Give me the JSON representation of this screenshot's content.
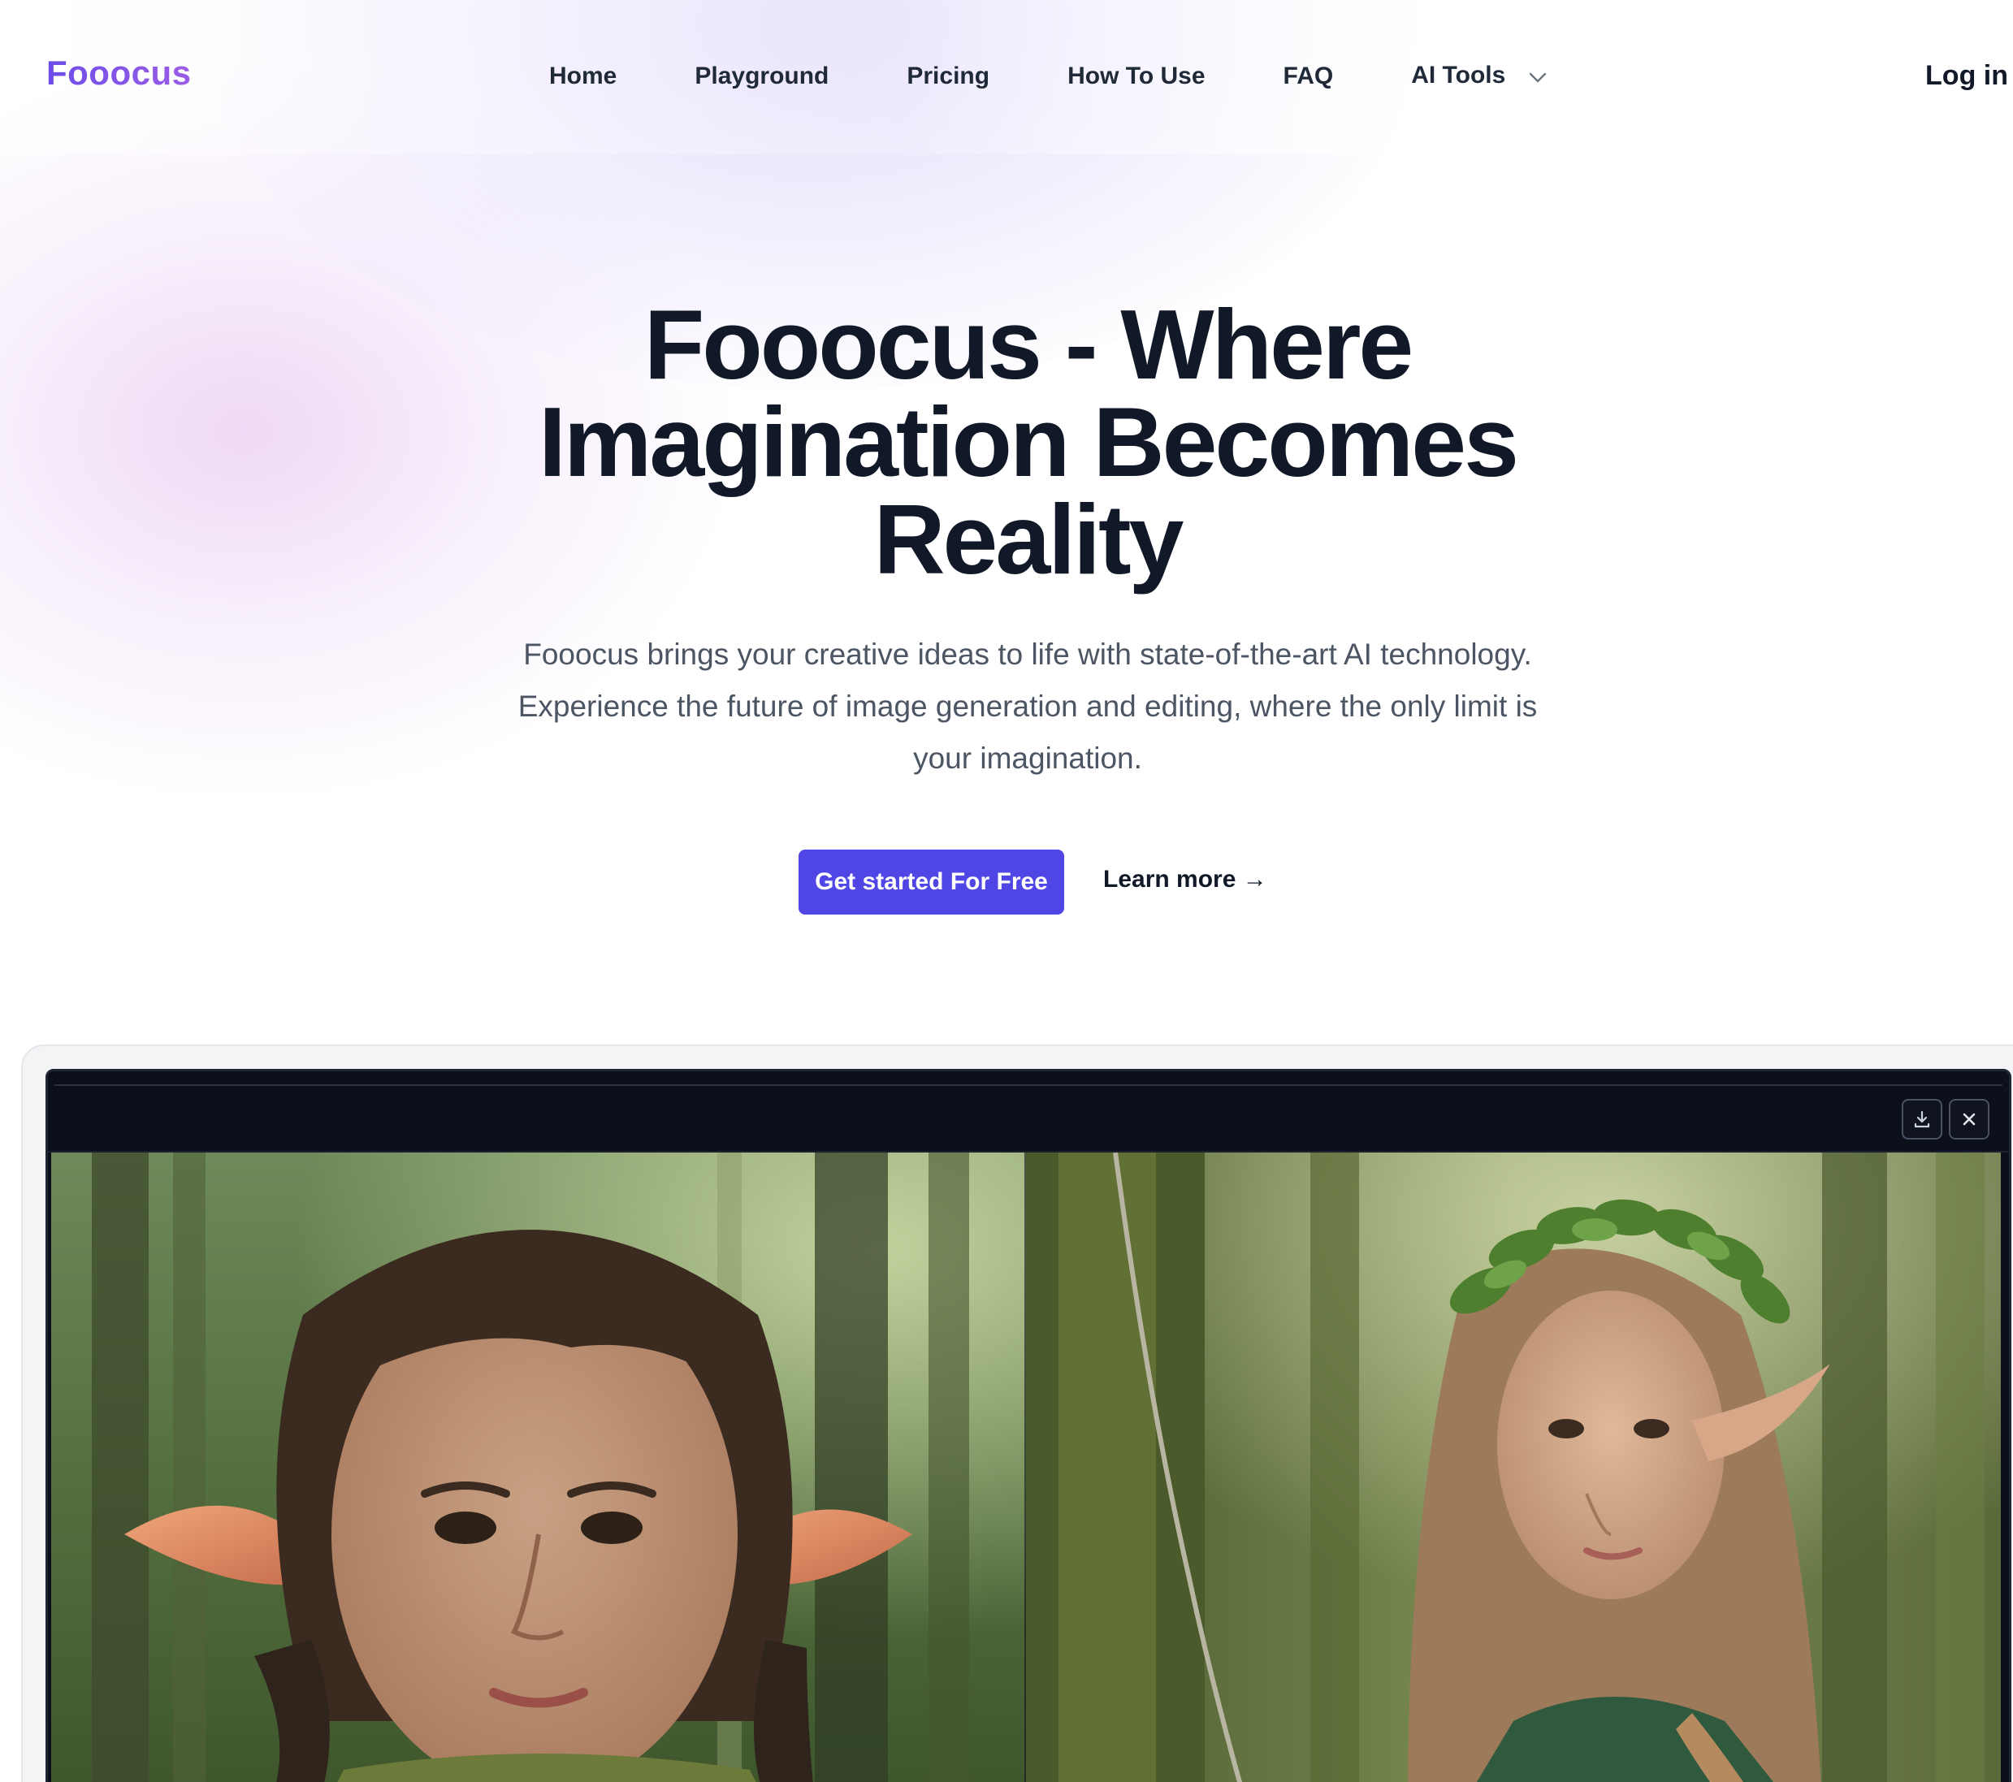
{
  "brand": {
    "logo": "Fooocus"
  },
  "nav": {
    "links": [
      "Home",
      "Playground",
      "Pricing",
      "How To Use",
      "FAQ"
    ],
    "ai_tools": "AI Tools",
    "login": "Log in"
  },
  "hero": {
    "title_lines": [
      "Fooocus - Where",
      "Imagination Becomes",
      "Reality"
    ],
    "subtitle_lines": [
      "Fooocus brings your creative ideas to life with state-of-the-art AI technology.",
      "Experience the future of image generation and editing, where the only limit is",
      "your imagination."
    ],
    "cta_primary": "Get started For Free",
    "cta_secondary": "Learn more →"
  },
  "preview": {
    "toolbar_icons": [
      "download-icon",
      "close-icon"
    ]
  },
  "colors": {
    "accent": "#4f46e5",
    "logo_gradient_start": "#6d4de8",
    "logo_gradient_end": "#9b5de5",
    "heading": "#111827",
    "body_text": "#4b5563",
    "preview_bg": "#0b101a"
  }
}
